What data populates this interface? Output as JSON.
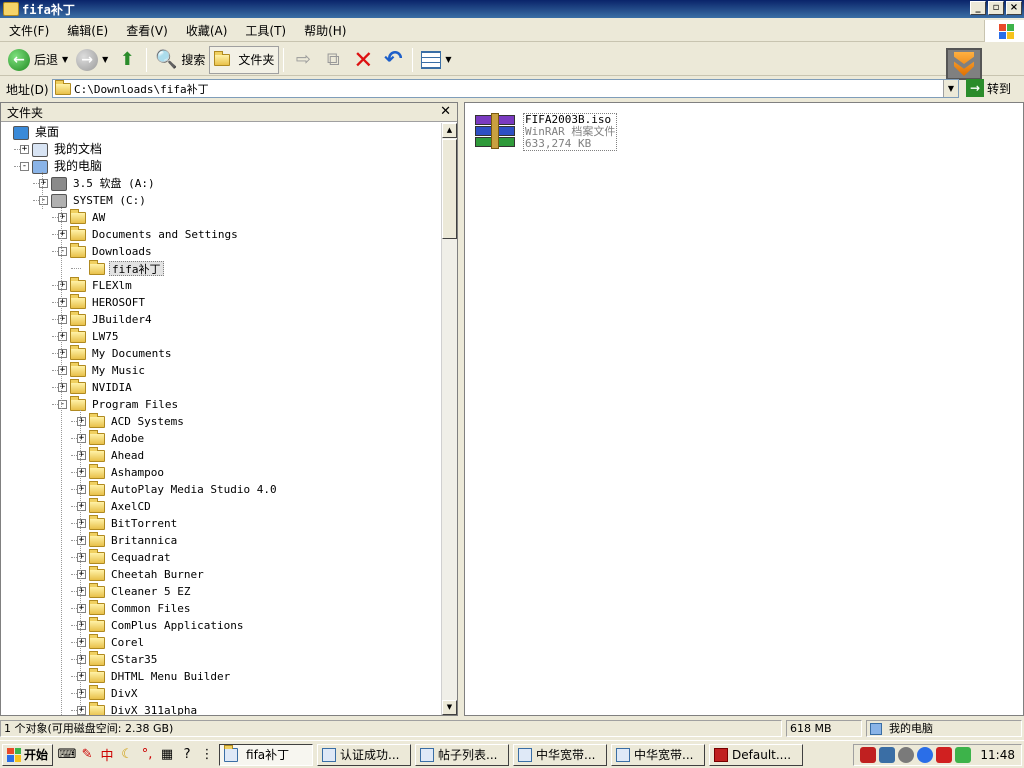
{
  "window": {
    "title": "fifa补丁"
  },
  "menu": [
    "文件(F)",
    "编辑(E)",
    "查看(V)",
    "收藏(A)",
    "工具(T)",
    "帮助(H)"
  ],
  "toolbar": {
    "back": "后退",
    "search": "搜索",
    "folders": "文件夹"
  },
  "address": {
    "label": "地址(D)",
    "value": "C:\\Downloads\\fifa补丁",
    "go": "转到"
  },
  "folders_panel": {
    "title": "文件夹"
  },
  "tree": [
    {
      "label": "桌面",
      "depth": 0,
      "icon": "desktop-icon",
      "exp": ""
    },
    {
      "label": "我的文档",
      "depth": 1,
      "icon": "documents-icon",
      "exp": "+"
    },
    {
      "label": "我的电脑",
      "depth": 1,
      "icon": "computer-icon",
      "exp": "-"
    },
    {
      "label": "3.5 软盘 (A:)",
      "depth": 2,
      "icon": "floppy-icon",
      "exp": "+"
    },
    {
      "label": "SYSTEM (C:)",
      "depth": 2,
      "icon": "drive-icon",
      "exp": "-"
    },
    {
      "label": "AW",
      "depth": 3,
      "icon": "folder-icon",
      "exp": "+"
    },
    {
      "label": "Documents and Settings",
      "depth": 3,
      "icon": "folder-icon",
      "exp": "+"
    },
    {
      "label": "Downloads",
      "depth": 3,
      "icon": "folder-icon",
      "exp": "-"
    },
    {
      "label": "fifa补丁",
      "depth": 4,
      "icon": "folder-open-icon",
      "exp": "",
      "selected": true
    },
    {
      "label": "FLEXlm",
      "depth": 3,
      "icon": "folder-icon",
      "exp": "+"
    },
    {
      "label": "HEROSOFT",
      "depth": 3,
      "icon": "folder-icon",
      "exp": "+"
    },
    {
      "label": "JBuilder4",
      "depth": 3,
      "icon": "folder-icon",
      "exp": "+"
    },
    {
      "label": "LW75",
      "depth": 3,
      "icon": "folder-icon",
      "exp": "+"
    },
    {
      "label": "My Documents",
      "depth": 3,
      "icon": "folder-icon",
      "exp": "+"
    },
    {
      "label": "My Music",
      "depth": 3,
      "icon": "folder-icon",
      "exp": "+"
    },
    {
      "label": "NVIDIA",
      "depth": 3,
      "icon": "folder-icon",
      "exp": "+"
    },
    {
      "label": "Program Files",
      "depth": 3,
      "icon": "folder-icon",
      "exp": "-"
    },
    {
      "label": "ACD Systems",
      "depth": 4,
      "icon": "folder-icon",
      "exp": "+"
    },
    {
      "label": "Adobe",
      "depth": 4,
      "icon": "folder-icon",
      "exp": "+"
    },
    {
      "label": "Ahead",
      "depth": 4,
      "icon": "folder-icon",
      "exp": "+"
    },
    {
      "label": "Ashampoo",
      "depth": 4,
      "icon": "folder-icon",
      "exp": "+"
    },
    {
      "label": "AutoPlay Media Studio 4.0",
      "depth": 4,
      "icon": "folder-icon",
      "exp": "+"
    },
    {
      "label": "AxelCD",
      "depth": 4,
      "icon": "folder-icon",
      "exp": "+"
    },
    {
      "label": "BitTorrent",
      "depth": 4,
      "icon": "folder-icon",
      "exp": "+"
    },
    {
      "label": "Britannica",
      "depth": 4,
      "icon": "folder-icon",
      "exp": "+"
    },
    {
      "label": "Cequadrat",
      "depth": 4,
      "icon": "folder-icon",
      "exp": "+"
    },
    {
      "label": "Cheetah Burner",
      "depth": 4,
      "icon": "folder-icon",
      "exp": "+"
    },
    {
      "label": "Cleaner 5 EZ",
      "depth": 4,
      "icon": "folder-icon",
      "exp": "+"
    },
    {
      "label": "Common Files",
      "depth": 4,
      "icon": "folder-icon",
      "exp": "+"
    },
    {
      "label": "ComPlus Applications",
      "depth": 4,
      "icon": "folder-icon",
      "exp": "+"
    },
    {
      "label": "Corel",
      "depth": 4,
      "icon": "folder-icon",
      "exp": "+"
    },
    {
      "label": "CStar35",
      "depth": 4,
      "icon": "folder-icon",
      "exp": "+"
    },
    {
      "label": "DHTML Menu Builder",
      "depth": 4,
      "icon": "folder-icon",
      "exp": "+"
    },
    {
      "label": "DivX",
      "depth": 4,
      "icon": "folder-icon",
      "exp": "+"
    },
    {
      "label": "DivX_311alpha",
      "depth": 4,
      "icon": "folder-icon",
      "exp": "+"
    }
  ],
  "file": {
    "name": "FIFA2003B.iso",
    "type": "WinRAR 档案文件",
    "size": "633,274 KB",
    "icon": "winrar-archive-icon"
  },
  "status": {
    "objects": "1 个对象(可用磁盘空间: 2.38 GB)",
    "size": "618 MB",
    "location": "我的电脑"
  },
  "taskbar": {
    "start": "开始",
    "tasks": [
      "fifa补丁",
      "认证成功...",
      "帖子列表...",
      "中华宽带...",
      "中华宽带...",
      "Default...."
    ],
    "clock": "11:48"
  },
  "colors": {
    "titlebar": "#0a246a",
    "face": "#ece9d8",
    "selection": "#e3e3e3"
  }
}
